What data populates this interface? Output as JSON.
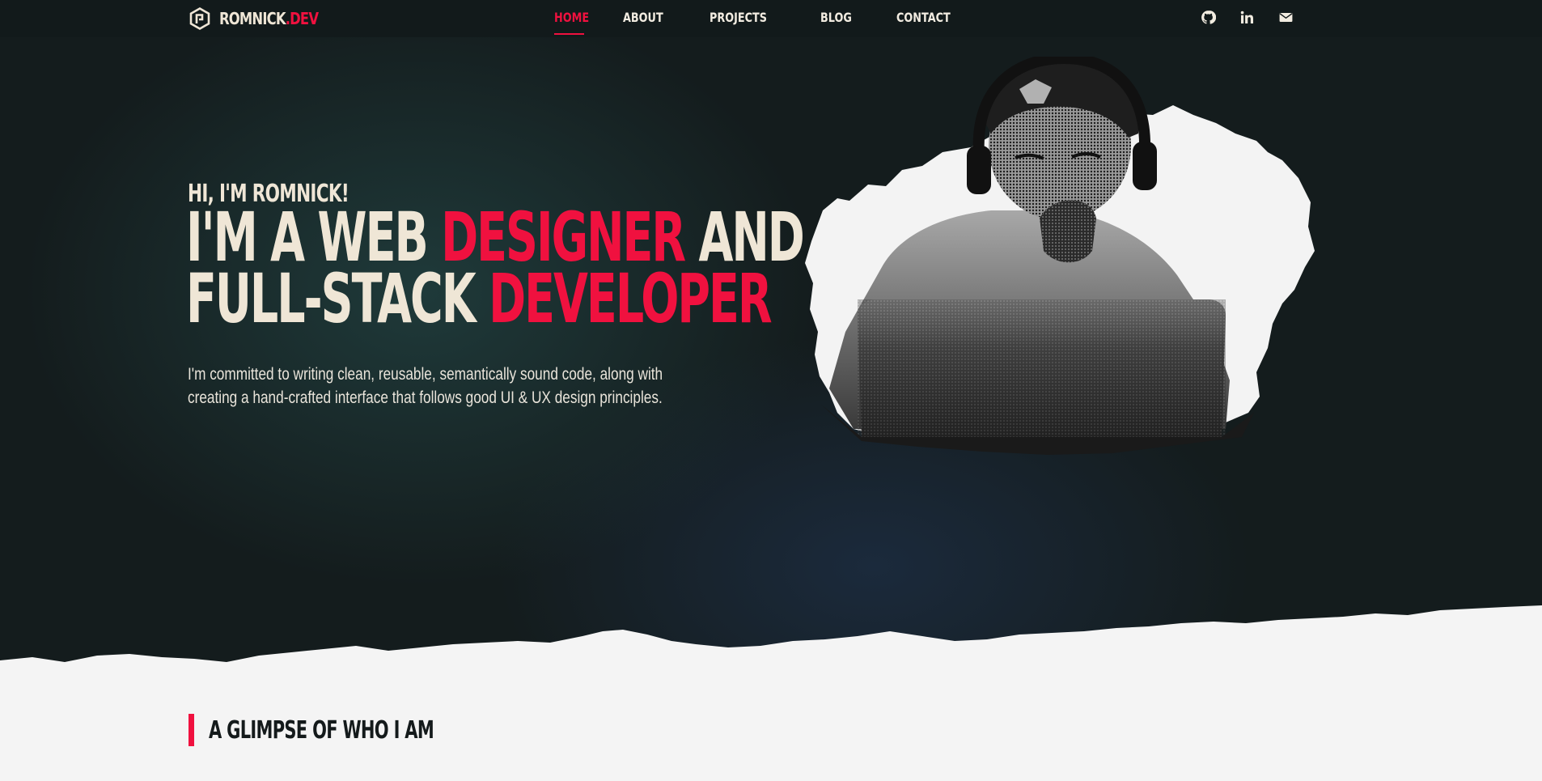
{
  "brand": {
    "name": "ROMNICK",
    "suffix": ".DEV",
    "logo_icon": "hexagon-logo-icon"
  },
  "nav": {
    "items": [
      {
        "label": "HOME",
        "active": true
      },
      {
        "label": "ABOUT",
        "active": false
      },
      {
        "label": "PROJECTS",
        "active": false
      },
      {
        "label": "BLOG",
        "active": false
      },
      {
        "label": "CONTACT",
        "active": false
      }
    ],
    "socials": [
      {
        "icon": "github-icon"
      },
      {
        "icon": "linkedin-icon"
      },
      {
        "icon": "envelope-icon"
      }
    ]
  },
  "hero": {
    "greeting": "HI, I'M ROMNICK!",
    "headline": {
      "line1_a": "I'M A WEB ",
      "line1_accent": "DESIGNER",
      "line1_b": " AND",
      "line2_a": "FULL-STACK ",
      "line2_accent": "DEVELOPER"
    },
    "intro": "I'm committed to writing clean, reusable, semantically sound code, along with creating a hand-crafted interface that follows good UI & UX design principles.",
    "portrait_alt": "Halftone portrait of a man in headphones and a backwards cap working on a laptop"
  },
  "section": {
    "title": "A GLIMPSE OF WHO I AM"
  },
  "colors": {
    "accent": "#f0113f",
    "cream": "#efe6d6",
    "dark": "#141c1d",
    "paper": "#f4f4f4"
  }
}
